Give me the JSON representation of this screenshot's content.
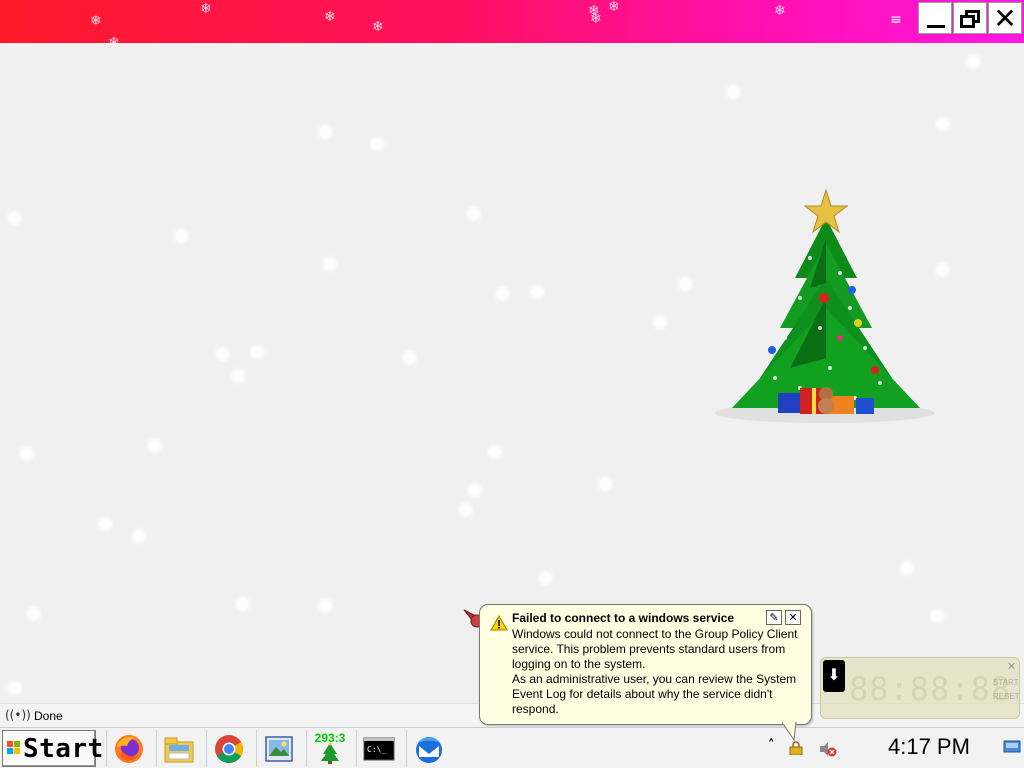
{
  "window": {
    "menu_icon": "hamburger-menu-icon",
    "controls": {
      "minimize_icon": "minimize-icon",
      "restore_icon": "restore-icon",
      "close_icon": "close-icon",
      "close_glyph": "✕"
    },
    "colors": {
      "titlebar_left": "#ff1a2a",
      "titlebar_right": "#ff18e0"
    }
  },
  "status_bar": {
    "icon": "wireless-signal-icon",
    "text": "Done"
  },
  "taskbar": {
    "start_label": "Start",
    "apps": [
      {
        "name": "firefox"
      },
      {
        "name": "file-manager"
      },
      {
        "name": "chrome"
      },
      {
        "name": "image-viewer"
      },
      {
        "name": "christmas-tree-counter",
        "counter": "293:3"
      },
      {
        "name": "command-prompt",
        "text": "C:\\_"
      },
      {
        "name": "thunderbird"
      }
    ],
    "tray": {
      "clock": "4:17 PM",
      "expand_glyph": "˄"
    }
  },
  "notification": {
    "title": "Failed to connect to a windows service",
    "body_1": "Windows could not connect to the Group Policy Client service. This problem prevents standard users from logging on to the system.",
    "body_2": "As an administrative user, you can review the System Event Log for details about why the service didn't respond.",
    "options_icon": "wrench-icon",
    "close_glyph": "✕"
  },
  "stopwatch": {
    "digits": "88:88:88",
    "start_label": "START",
    "reset_label": "RESET",
    "close_glyph": "✕"
  }
}
